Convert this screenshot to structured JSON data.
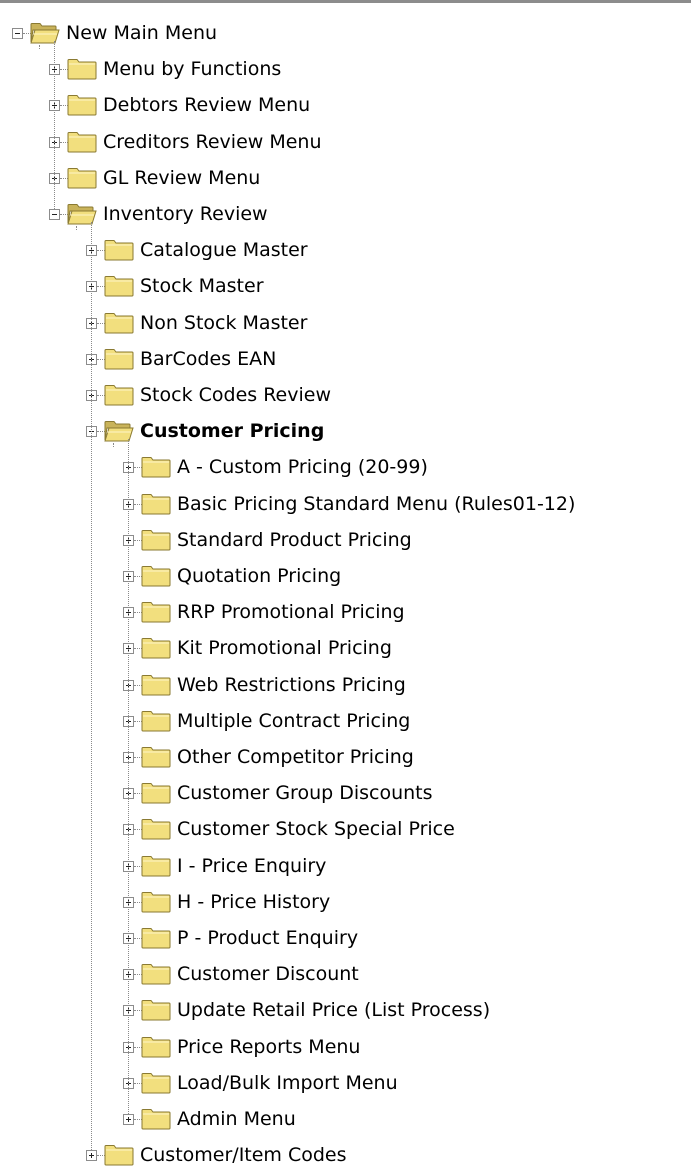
{
  "tree": {
    "root": {
      "label": "New Main Menu",
      "icon": "folder-open-icon",
      "expanded": true,
      "children": [
        {
          "label": "Menu by Functions",
          "icon": "folder-icon",
          "expanded": false
        },
        {
          "label": "Debtors Review Menu",
          "icon": "folder-icon",
          "expanded": false
        },
        {
          "label": "Creditors Review Menu",
          "icon": "folder-icon",
          "expanded": false
        },
        {
          "label": "GL Review Menu",
          "icon": "folder-icon",
          "expanded": false
        },
        {
          "label": "Inventory Review",
          "icon": "folder-open-icon",
          "expanded": true,
          "children": [
            {
              "label": "Catalogue Master",
              "icon": "folder-icon",
              "expanded": false
            },
            {
              "label": "Stock Master",
              "icon": "folder-icon",
              "expanded": false
            },
            {
              "label": "Non Stock Master",
              "icon": "folder-icon",
              "expanded": false
            },
            {
              "label": "BarCodes EAN",
              "icon": "folder-icon",
              "expanded": false
            },
            {
              "label": "Stock Codes Review",
              "icon": "folder-icon",
              "expanded": false
            },
            {
              "label": "Customer Pricing",
              "icon": "folder-open-icon",
              "expanded": true,
              "selected": true,
              "children": [
                {
                  "label": "A - Custom Pricing    (20-99)",
                  "icon": "folder-icon",
                  "expanded": false
                },
                {
                  "label": "Basic Pricing Standard Menu (Rules01-12)",
                  "icon": "folder-icon",
                  "expanded": false
                },
                {
                  "label": "Standard Product Pricing",
                  "icon": "folder-icon",
                  "expanded": false
                },
                {
                  "label": "Quotation Pricing",
                  "icon": "folder-icon",
                  "expanded": false
                },
                {
                  "label": "RRP Promotional Pricing",
                  "icon": "folder-icon",
                  "expanded": false
                },
                {
                  "label": "Kit Promotional Pricing",
                  "icon": "folder-icon",
                  "expanded": false
                },
                {
                  "label": "Web Restrictions Pricing",
                  "icon": "folder-icon",
                  "expanded": false
                },
                {
                  "label": "Multiple Contract Pricing",
                  "icon": "folder-icon",
                  "expanded": false
                },
                {
                  "label": "Other Competitor Pricing",
                  "icon": "folder-icon",
                  "expanded": false
                },
                {
                  "label": "Customer Group Discounts",
                  "icon": "folder-icon",
                  "expanded": false
                },
                {
                  "label": "Customer Stock Special Price",
                  "icon": "folder-icon",
                  "expanded": false
                },
                {
                  "label": "I - Price Enquiry",
                  "icon": "folder-icon",
                  "expanded": false
                },
                {
                  "label": "H - Price History",
                  "icon": "folder-icon",
                  "expanded": false
                },
                {
                  "label": "P - Product Enquiry",
                  "icon": "folder-icon",
                  "expanded": false
                },
                {
                  "label": "Customer Discount",
                  "icon": "folder-icon",
                  "expanded": false
                },
                {
                  "label": "Update Retail Price (List Process)",
                  "icon": "folder-icon",
                  "expanded": false
                },
                {
                  "label": "Price Reports Menu",
                  "icon": "folder-icon",
                  "expanded": false
                },
                {
                  "label": "Load/Bulk Import Menu",
                  "icon": "folder-icon",
                  "expanded": false
                },
                {
                  "label": "Admin Menu",
                  "icon": "folder-icon",
                  "expanded": false
                }
              ]
            },
            {
              "label": "Customer/Item Codes",
              "icon": "folder-icon",
              "expanded": false
            }
          ]
        }
      ]
    }
  },
  "colors": {
    "folder_fill": "#f2df7e",
    "folder_edge": "#8a7a32",
    "connector": "#8a8a8a"
  }
}
